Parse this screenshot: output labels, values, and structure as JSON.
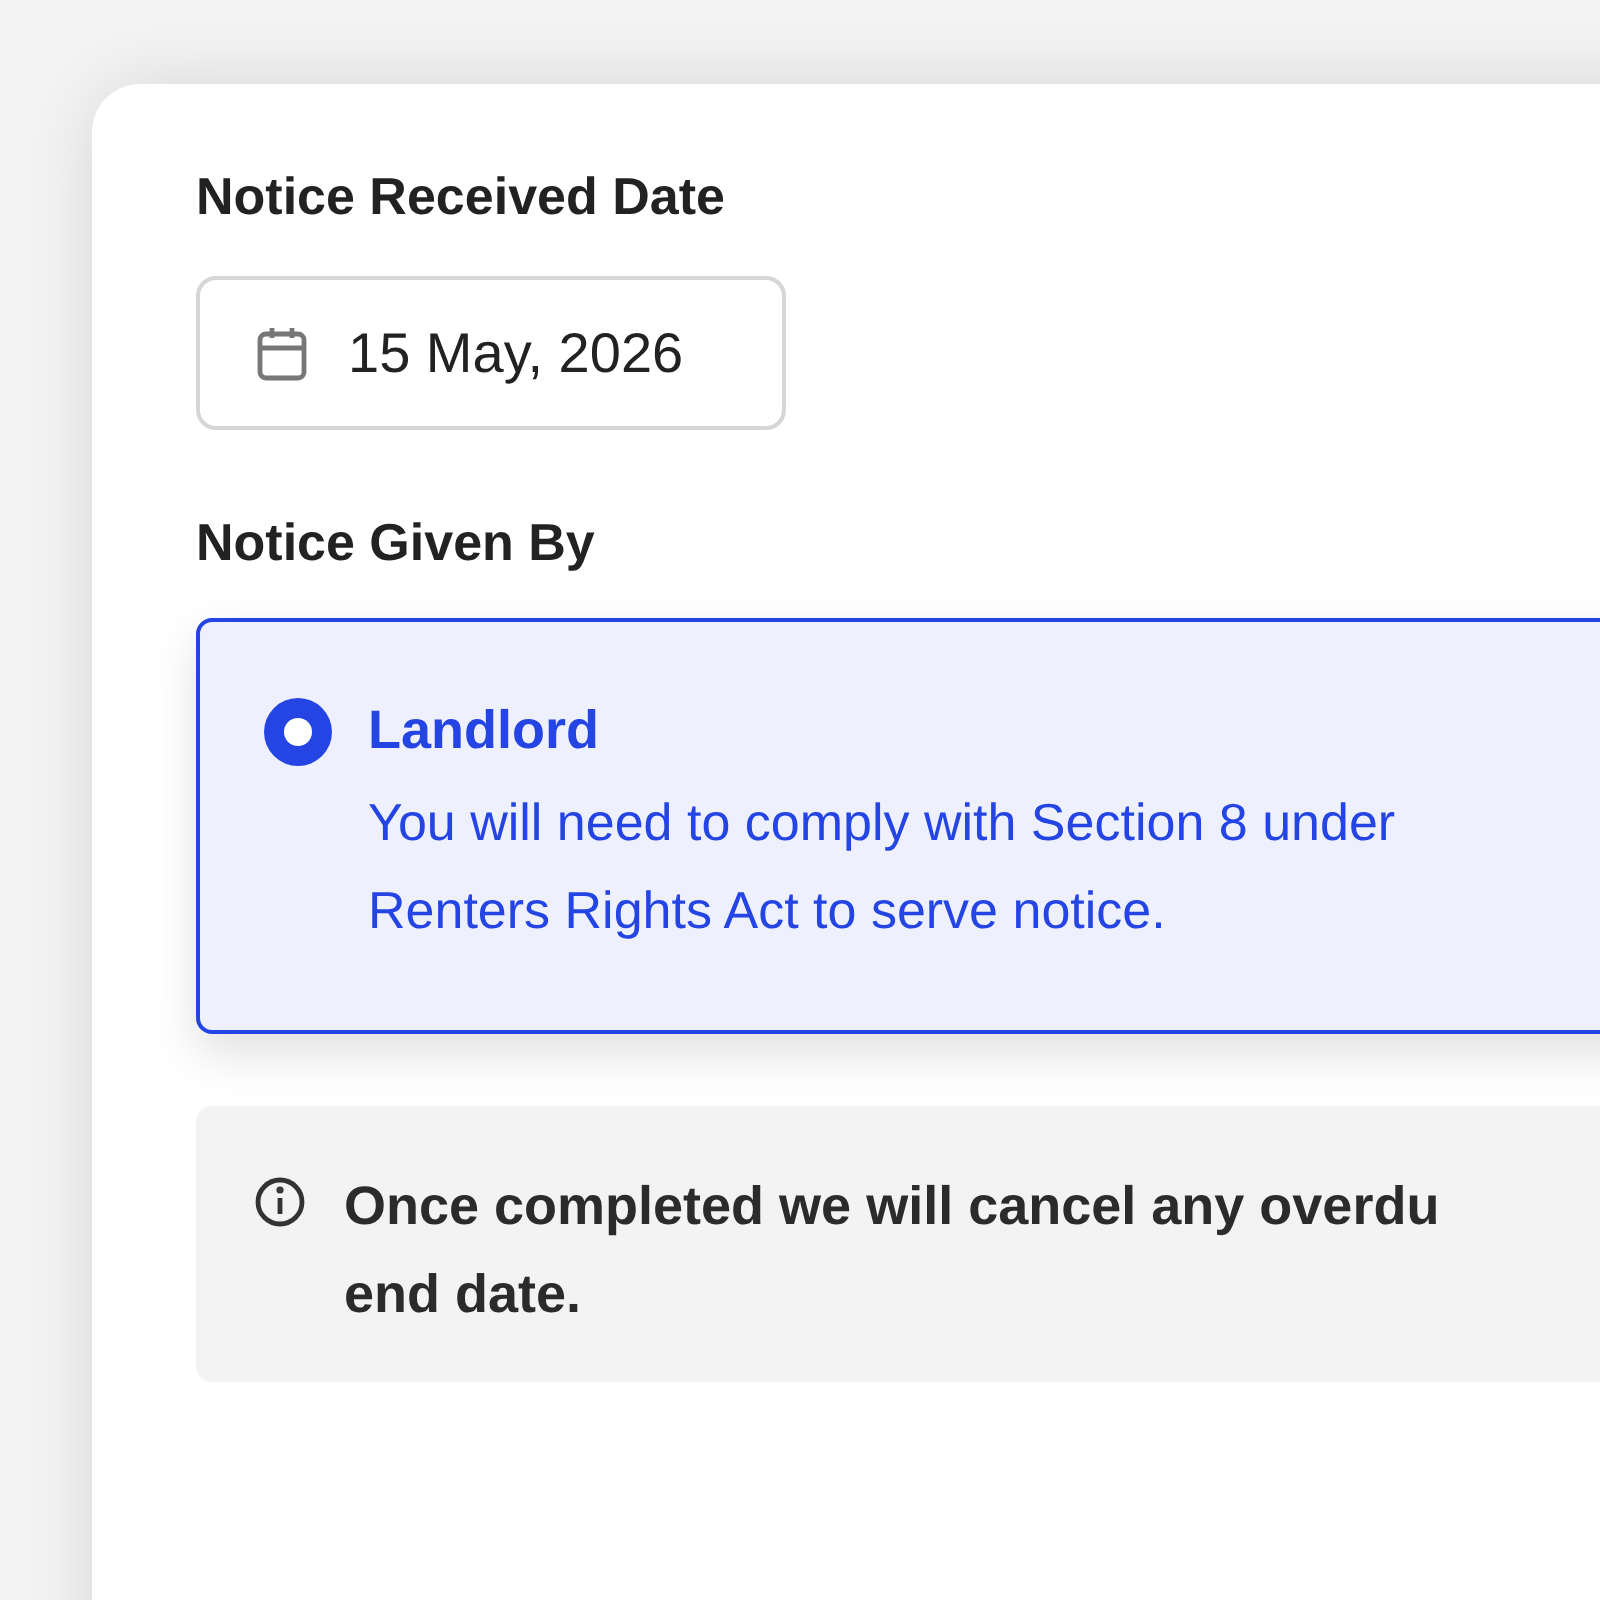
{
  "date_field": {
    "label": "Notice Received Date",
    "value": "15 May, 2026"
  },
  "notice_given_by": {
    "label": "Notice Given By",
    "options": [
      {
        "title": "Landlord",
        "description": "You will need to comply with Section 8 under Renters Rights Act to serve notice.",
        "selected": true
      }
    ]
  },
  "info": {
    "lines": [
      "Once completed we will cancel any overdu",
      "end date."
    ]
  }
}
